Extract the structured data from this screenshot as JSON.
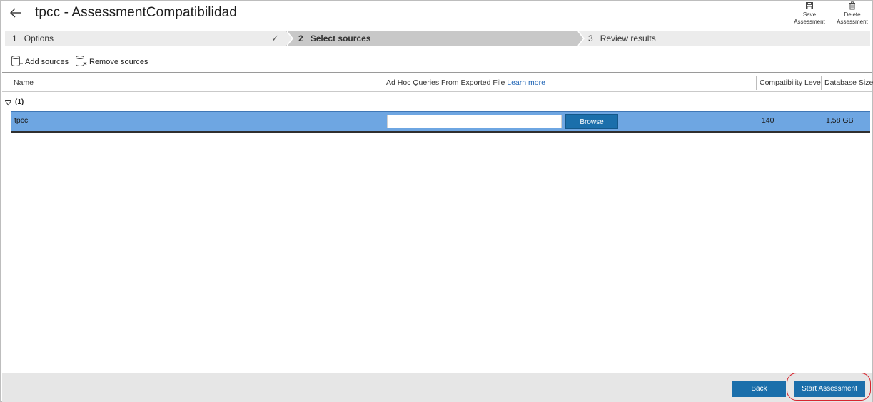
{
  "header": {
    "title": "tpcc - AssessmentCompatibilidad",
    "actions": [
      {
        "line1": "Save",
        "line2": "Assessment",
        "icon": "save-icon"
      },
      {
        "line1": "Delete",
        "line2": "Assessment",
        "icon": "trash-icon"
      }
    ]
  },
  "stepper": {
    "steps": [
      {
        "number": "1",
        "label": "Options",
        "state": "completed"
      },
      {
        "number": "2",
        "label": "Select sources",
        "state": "active"
      },
      {
        "number": "3",
        "label": "Review results",
        "state": "pending"
      }
    ],
    "check_glyph": "✓"
  },
  "toolbar": {
    "add_label": "Add sources",
    "remove_label": "Remove sources"
  },
  "grid": {
    "columns": {
      "name": "Name",
      "adhoc": "Ad Hoc Queries From Exported File",
      "adhoc_link": "Learn more",
      "compat": "Compatibility Level",
      "size": "Database Size"
    },
    "group_label": "(1)",
    "rows": [
      {
        "name": "tpcc",
        "file_value": "",
        "browse_label": "Browse",
        "compat": "140",
        "size": "1,58 GB"
      }
    ]
  },
  "footer": {
    "back_label": "Back",
    "start_label": "Start Assessment"
  },
  "colors": {
    "accent": "#1b6fab",
    "selected_row": "#6ea6e2",
    "highlight": "#d6262f"
  }
}
